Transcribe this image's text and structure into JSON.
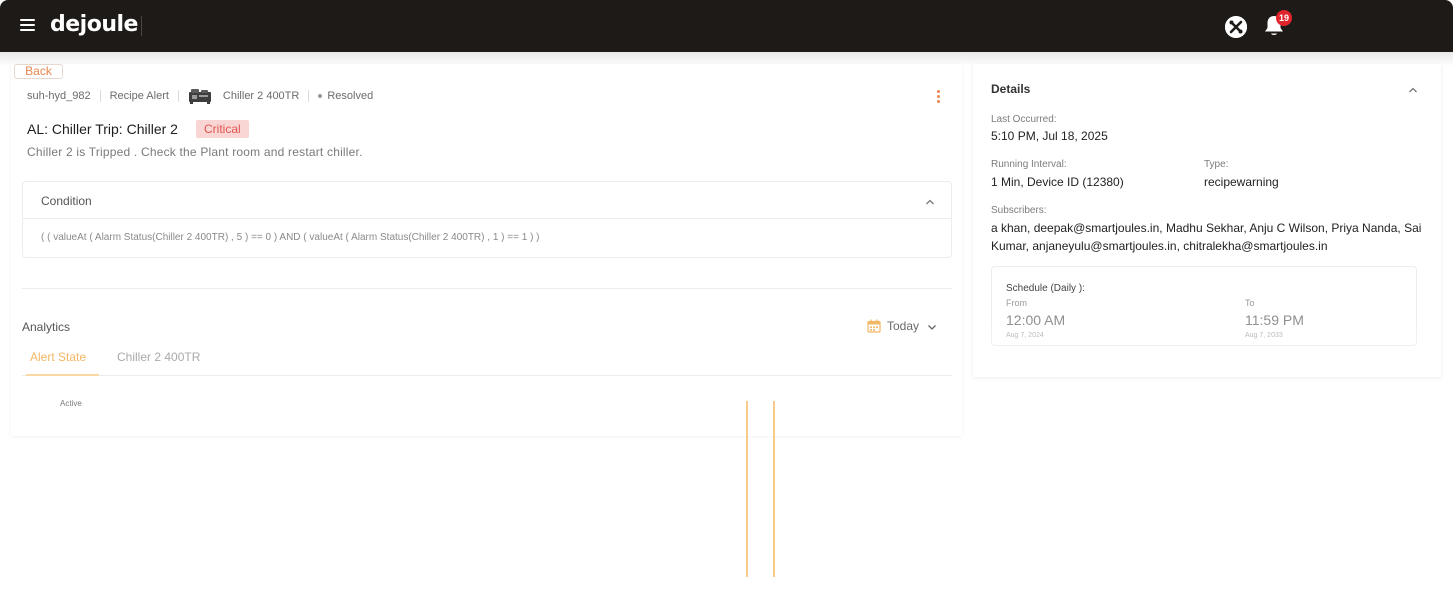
{
  "header": {
    "logo_text": "dejoule",
    "notification_count": "19",
    "icons": [
      "menu-icon",
      "tools-icon",
      "bell-icon"
    ]
  },
  "back_label": "Back",
  "alert": {
    "site_id": "suh-hyd_982",
    "alert_type": "Recipe Alert",
    "device_name": "Chiller 2 400TR",
    "status": "Resolved",
    "title": "AL: Chiller Trip: Chiller 2",
    "severity": "Critical",
    "description": "Chiller 2 is Tripped . Check the Plant room and restart chiller."
  },
  "condition": {
    "title": "Condition",
    "expression": "( ( valueAt ( Alarm Status(Chiller 2 400TR) , 5 ) == 0 ) AND ( valueAt ( Alarm Status(Chiller 2 400TR) , 1 ) == 1 ) )"
  },
  "analytics": {
    "title": "Analytics",
    "range_label": "Today",
    "tabs": [
      {
        "label": "Alert State",
        "active": true
      },
      {
        "label": "Chiller 2 400TR",
        "active": false
      }
    ]
  },
  "chart_data": {
    "type": "bar",
    "ylabel": "Active",
    "series": [
      {
        "values": [
          1,
          1
        ]
      }
    ],
    "colors": [
      "#f7c98a"
    ]
  },
  "details": {
    "title": "Details",
    "last_occurred_label": "Last Occurred:",
    "last_occurred_value": "5:10 PM, Jul 18, 2025",
    "running_interval_label": "Running Interval:",
    "running_interval_value": "1 Min, Device ID (12380)",
    "type_label": "Type:",
    "type_value": "recipewarning",
    "subscribers_label": "Subscribers:",
    "subscribers_line1": "a khan, deepak@smartjoules.in, Madhu Sekhar, Anju C Wilson, Priya Nanda, Sai",
    "subscribers_line2": "Kumar, anjaneyulu@smartjoules.in, chitralekha@smartjoules.in",
    "schedule": {
      "title": "Schedule (Daily ):",
      "from_label": "From",
      "from_time": "12:00 AM",
      "from_date": "Aug 7, 2024",
      "to_label": "To",
      "to_time": "11:59 PM",
      "to_date": "Aug 7, 2033"
    }
  },
  "colors": {
    "header_bg": "#1e1a17",
    "accent": "#e8874f",
    "critical_bg": "#f9d6d4",
    "critical_text": "#e0554f",
    "badge": "#e0242b",
    "tab_active": "#f2b765"
  }
}
